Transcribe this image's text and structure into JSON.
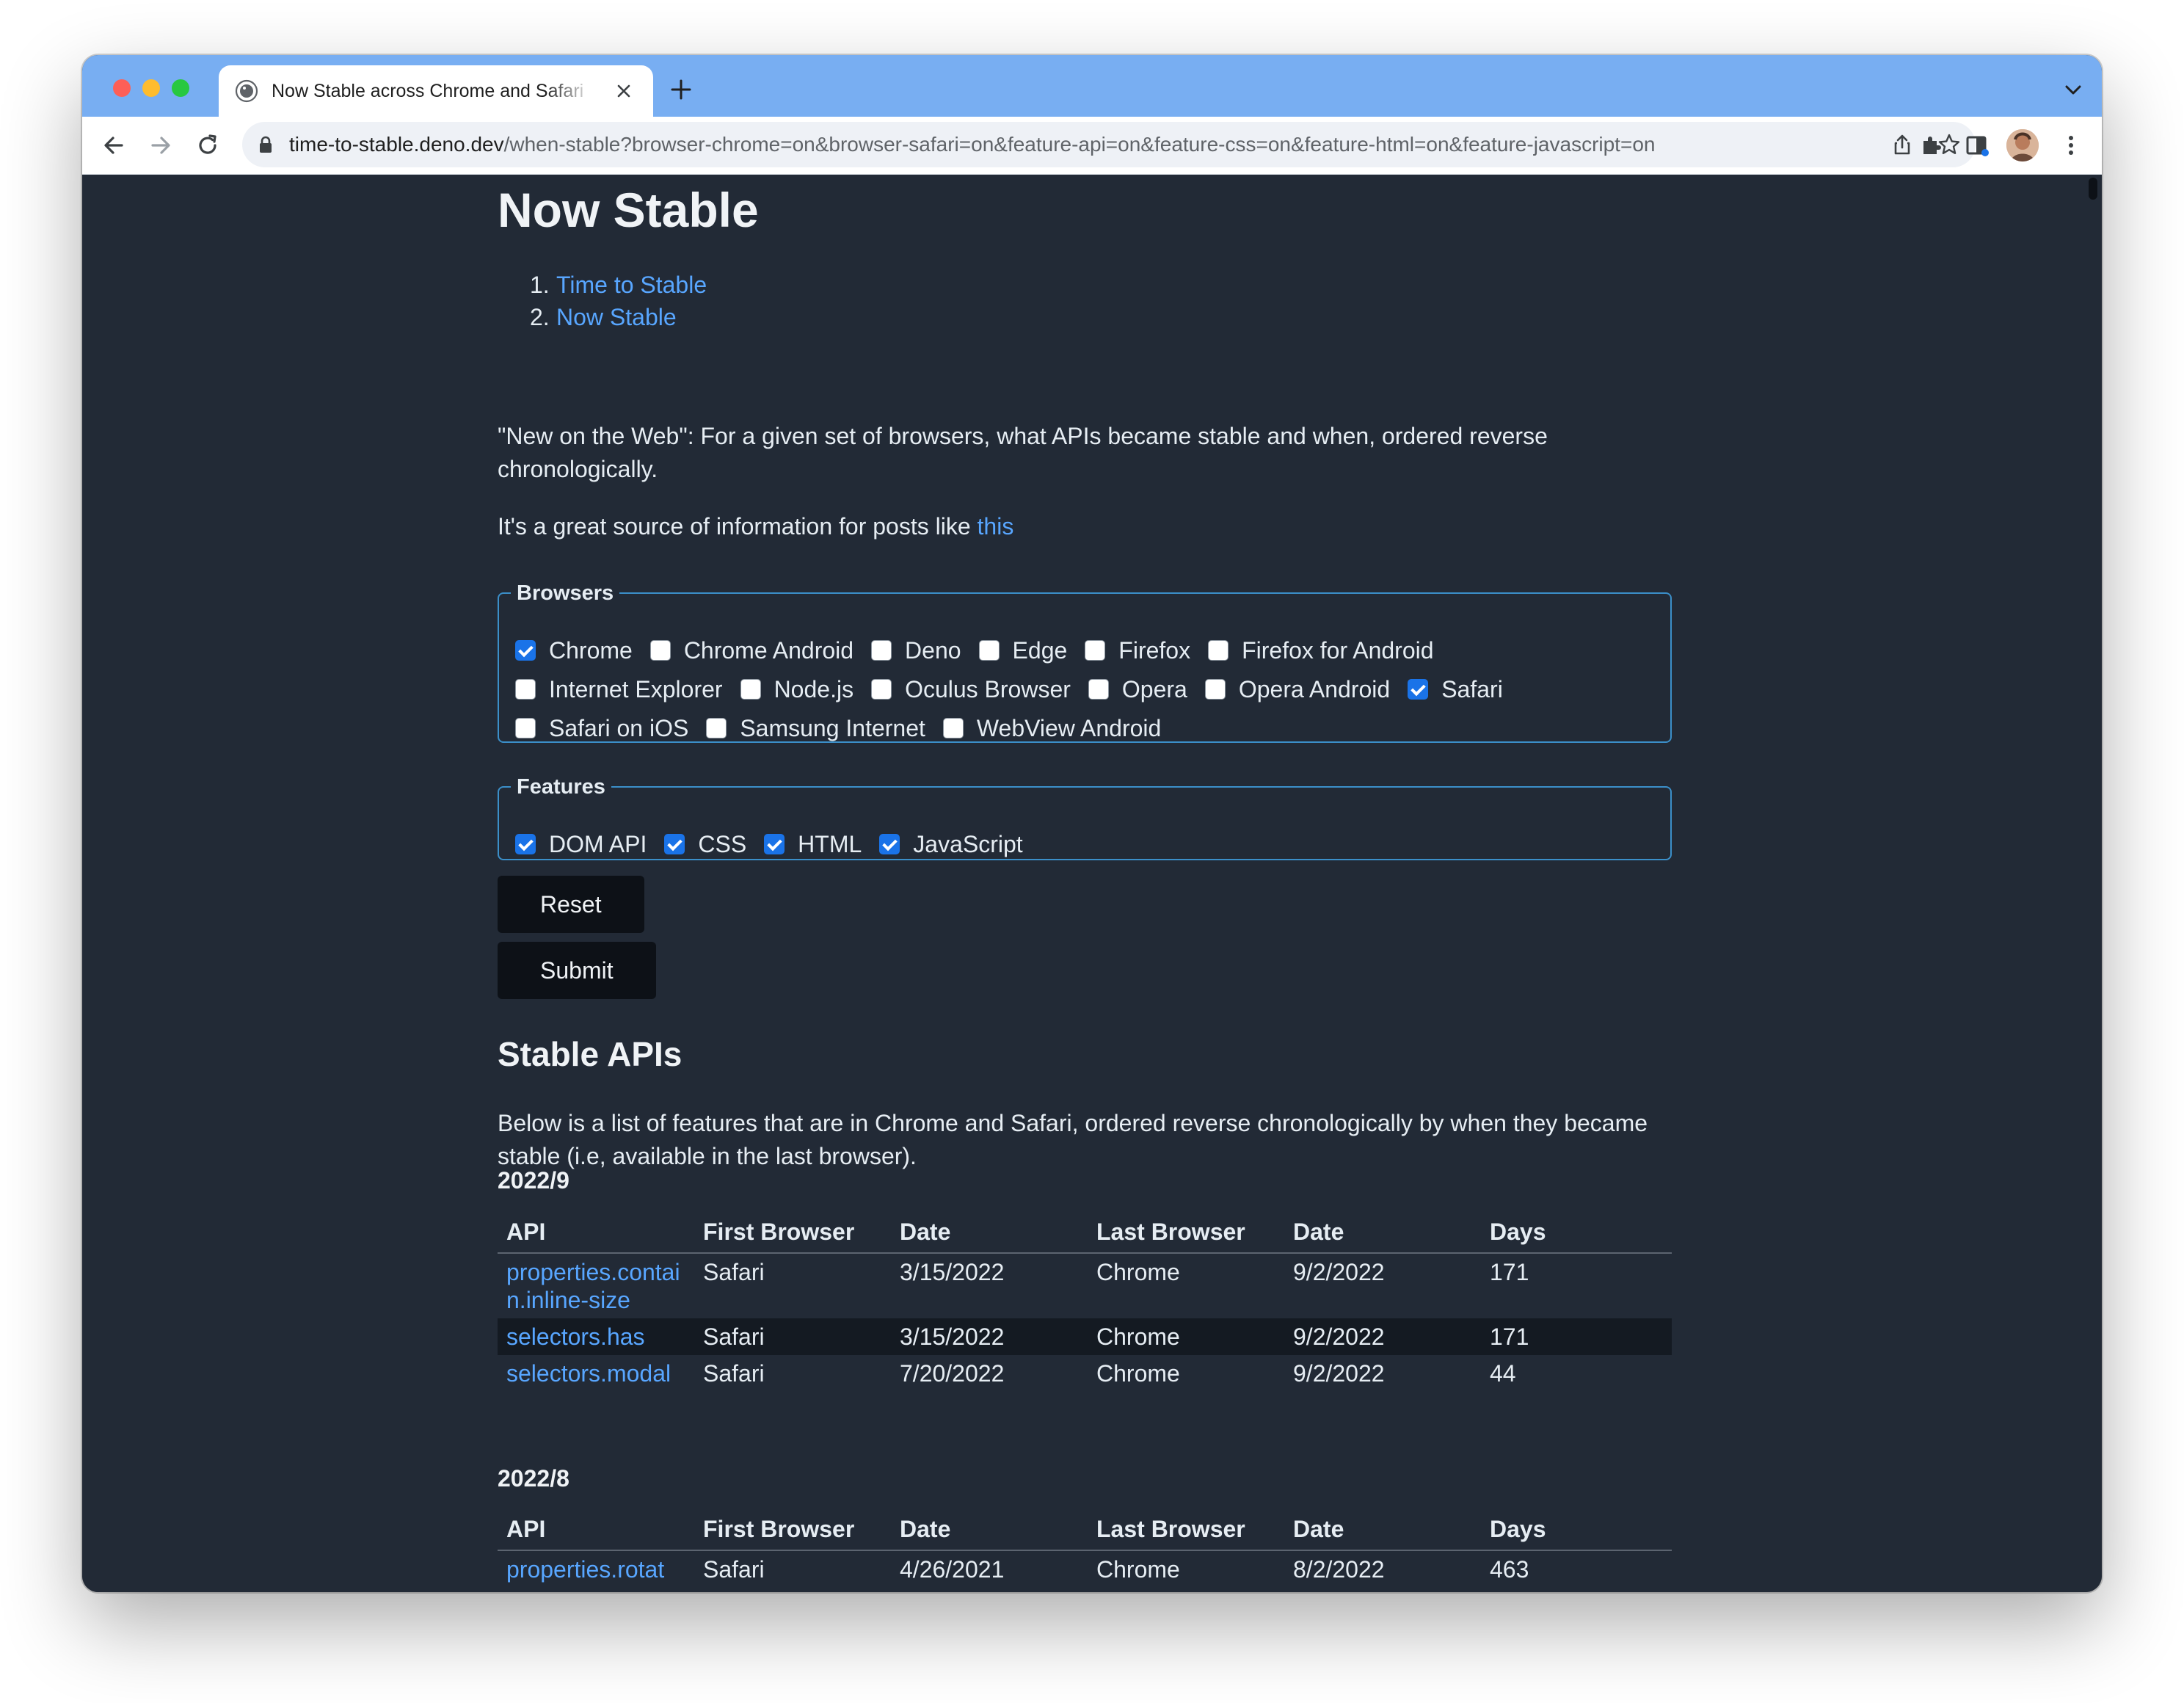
{
  "browser": {
    "tab_title": "Now Stable across Chrome and Safari",
    "url_host": "time-to-stable.deno.dev",
    "url_path": "/when-stable?browser-chrome=on&browser-safari=on&feature-api=on&feature-css=on&feature-html=on&feature-javascript=on"
  },
  "page": {
    "title": "Now Stable",
    "toc": [
      {
        "num": "1.",
        "label": "Time to Stable"
      },
      {
        "num": "2.",
        "label": "Now Stable"
      }
    ],
    "intro": "\"New on the Web\": For a given set of browsers, what APIs became stable and when, ordered reverse chronologically.",
    "source_text": "It's a great source of information for posts like",
    "source_link": "this",
    "browsers_legend": "Browsers",
    "browsers": [
      {
        "label": "Chrome",
        "checked": true
      },
      {
        "label": "Chrome Android",
        "checked": false
      },
      {
        "label": "Deno",
        "checked": false
      },
      {
        "label": "Edge",
        "checked": false
      },
      {
        "label": "Firefox",
        "checked": false
      },
      {
        "label": "Firefox for Android",
        "checked": false
      },
      {
        "label": "Internet Explorer",
        "checked": false
      },
      {
        "label": "Node.js",
        "checked": false
      },
      {
        "label": "Oculus Browser",
        "checked": false
      },
      {
        "label": "Opera",
        "checked": false
      },
      {
        "label": "Opera Android",
        "checked": false
      },
      {
        "label": "Safari",
        "checked": true
      },
      {
        "label": "Safari on iOS",
        "checked": false
      },
      {
        "label": "Samsung Internet",
        "checked": false
      },
      {
        "label": "WebView Android",
        "checked": false
      }
    ],
    "features_legend": "Features",
    "features": [
      {
        "label": "DOM API",
        "checked": true
      },
      {
        "label": "CSS",
        "checked": true
      },
      {
        "label": "HTML",
        "checked": true
      },
      {
        "label": "JavaScript",
        "checked": true
      }
    ],
    "reset_label": "Reset",
    "submit_label": "Submit",
    "section_title": "Stable APIs",
    "section_desc": "Below is a list of features that are in Chrome and Safari, ordered reverse chronologically by when they became stable (i.e, available in the last browser).",
    "table_headers": [
      "API",
      "First Browser",
      "Date",
      "Last Browser",
      "Date",
      "Days"
    ],
    "groups": [
      {
        "heading": "2022/9",
        "rows": [
          {
            "api": "properties.contain.inline-size",
            "first": "Safari",
            "first_date": "3/15/2022",
            "last": "Chrome",
            "last_date": "9/2/2022",
            "days": "171"
          },
          {
            "api": "selectors.has",
            "first": "Safari",
            "first_date": "3/15/2022",
            "last": "Chrome",
            "last_date": "9/2/2022",
            "days": "171"
          },
          {
            "api": "selectors.modal",
            "first": "Safari",
            "first_date": "7/20/2022",
            "last": "Chrome",
            "last_date": "9/2/2022",
            "days": "44"
          }
        ]
      },
      {
        "heading": "2022/8",
        "rows": [
          {
            "api": "properties.rotat",
            "first": "Safari",
            "first_date": "4/26/2021",
            "last": "Chrome",
            "last_date": "8/2/2022",
            "days": "463"
          }
        ]
      }
    ]
  }
}
